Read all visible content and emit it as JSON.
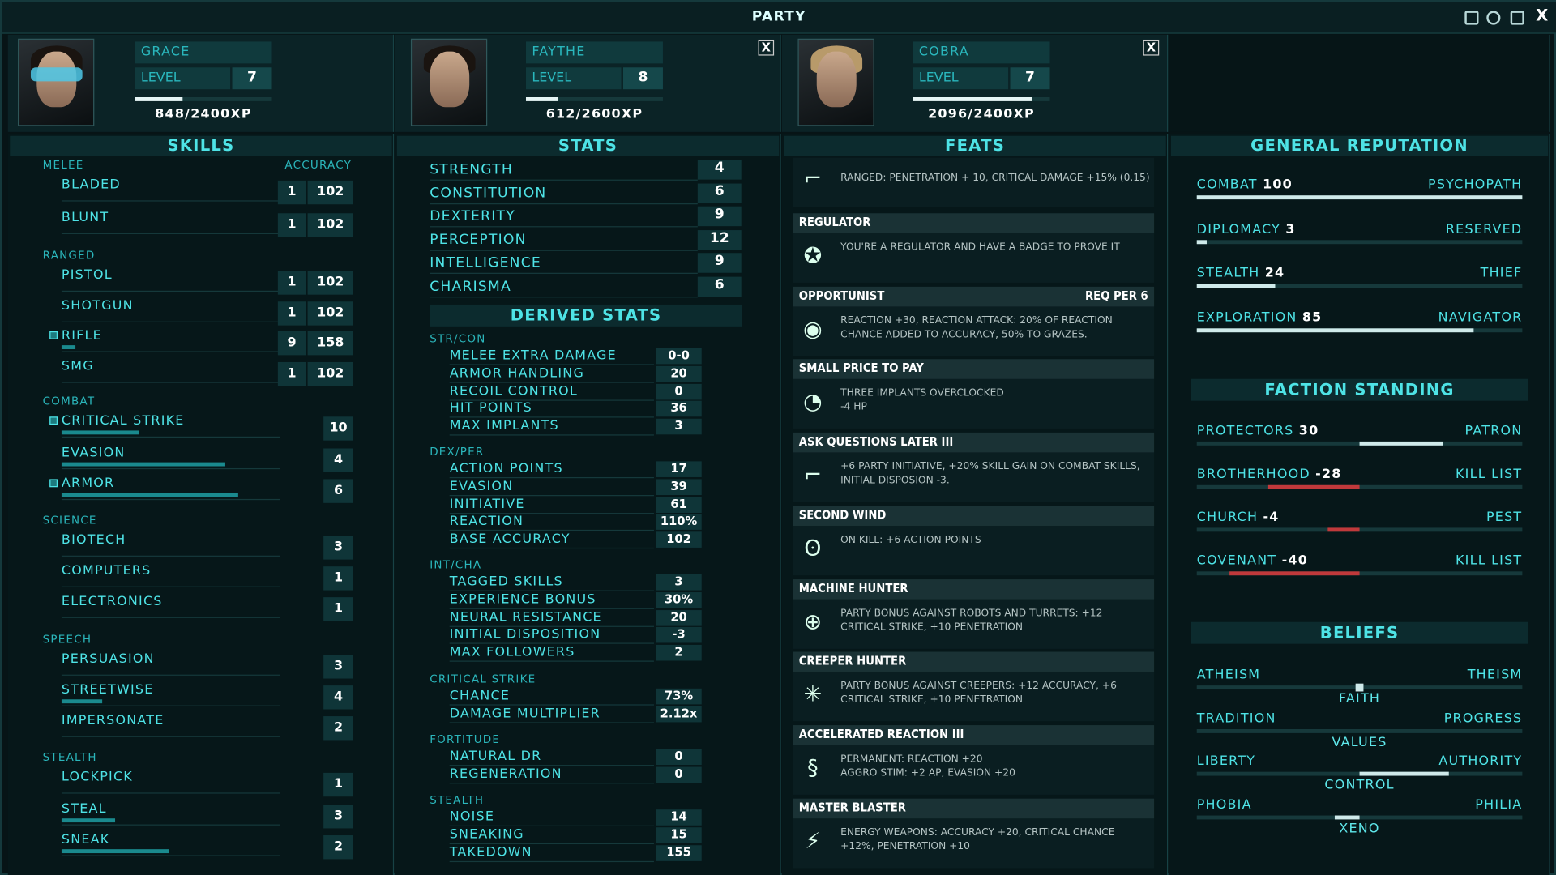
{
  "window": {
    "title": "PARTY",
    "close": "X"
  },
  "party": [
    {
      "name": "GRACE",
      "level_label": "LEVEL",
      "level": "7",
      "xp": "848/2400XP",
      "xp_fraction": 0.35
    },
    {
      "name": "FAYTHE",
      "level_label": "LEVEL",
      "level": "8",
      "xp": "612/2600XP",
      "xp_fraction": 0.235,
      "close": "X"
    },
    {
      "name": "COBRA",
      "level_label": "LEVEL",
      "level": "7",
      "xp": "2096/2400XP",
      "xp_fraction": 0.87,
      "close": "X"
    }
  ],
  "skills": {
    "header": "SKILLS",
    "accuracy_label": "ACCURACY",
    "melee_label": "MELEE",
    "ranged_label": "RANGED",
    "combat_label": "COMBAT",
    "science_label": "SCIENCE",
    "speech_label": "SPEECH",
    "stealth_label": "STEALTH",
    "melee": [
      {
        "name": "BLADED",
        "value": "1",
        "accuracy": "102"
      },
      {
        "name": "BLUNT",
        "value": "1",
        "accuracy": "102"
      }
    ],
    "ranged": [
      {
        "name": "PISTOL",
        "value": "1",
        "accuracy": "102"
      },
      {
        "name": "SHOTGUN",
        "value": "1",
        "accuracy": "102"
      },
      {
        "name": "RIFLE",
        "value": "9",
        "accuracy": "158",
        "tagged": true,
        "progress": 0.05
      },
      {
        "name": "SMG",
        "value": "1",
        "accuracy": "102"
      }
    ],
    "combat": [
      {
        "name": "CRITICAL STRIKE",
        "value": "10",
        "tagged": true,
        "progress": 0.29
      },
      {
        "name": "EVASION",
        "value": "4",
        "progress": 0.61
      },
      {
        "name": "ARMOR",
        "value": "6",
        "tagged": true,
        "progress": 0.66
      }
    ],
    "science": [
      {
        "name": "BIOTECH",
        "value": "3"
      },
      {
        "name": "COMPUTERS",
        "value": "1"
      },
      {
        "name": "ELECTRONICS",
        "value": "1"
      }
    ],
    "speech": [
      {
        "name": "PERSUASION",
        "value": "3"
      },
      {
        "name": "STREETWISE",
        "value": "4",
        "progress": 0.15
      },
      {
        "name": "IMPERSONATE",
        "value": "2"
      }
    ],
    "stealth": [
      {
        "name": "LOCKPICK",
        "value": "1"
      },
      {
        "name": "STEAL",
        "value": "3",
        "progress": 0.2
      },
      {
        "name": "SNEAK",
        "value": "2",
        "progress": 0.4
      }
    ]
  },
  "stats": {
    "header": "STATS",
    "primary": [
      {
        "name": "STRENGTH",
        "value": "4"
      },
      {
        "name": "CONSTITUTION",
        "value": "6"
      },
      {
        "name": "DEXTERITY",
        "value": "9"
      },
      {
        "name": "PERCEPTION",
        "value": "12"
      },
      {
        "name": "INTELLIGENCE",
        "value": "9"
      },
      {
        "name": "CHARISMA",
        "value": "6"
      }
    ],
    "derived_header": "DERIVED STATS",
    "groups": [
      {
        "label": "STR/CON",
        "items": [
          {
            "name": "MELEE EXTRA DAMAGE",
            "value": "0-0"
          },
          {
            "name": "ARMOR HANDLING",
            "value": "20"
          },
          {
            "name": "RECOIL CONTROL",
            "value": "0"
          },
          {
            "name": "HIT POINTS",
            "value": "36"
          },
          {
            "name": "MAX IMPLANTS",
            "value": "3"
          }
        ]
      },
      {
        "label": "DEX/PER",
        "items": [
          {
            "name": "ACTION POINTS",
            "value": "17"
          },
          {
            "name": "EVASION",
            "value": "39"
          },
          {
            "name": "INITIATIVE",
            "value": "61"
          },
          {
            "name": "REACTION",
            "value": "110%"
          },
          {
            "name": "BASE ACCURACY",
            "value": "102"
          }
        ]
      },
      {
        "label": "INT/CHA",
        "items": [
          {
            "name": "TAGGED SKILLS",
            "value": "3"
          },
          {
            "name": "EXPERIENCE BONUS",
            "value": "30%"
          },
          {
            "name": "NEURAL RESISTANCE",
            "value": "20"
          },
          {
            "name": "INITIAL DISPOSITION",
            "value": "-3"
          },
          {
            "name": "MAX FOLLOWERS",
            "value": "2"
          }
        ]
      },
      {
        "label": "CRITICAL STRIKE",
        "items": [
          {
            "name": "CHANCE",
            "value": "73%"
          },
          {
            "name": "DAMAGE MULTIPLIER",
            "value": "2.12x"
          }
        ]
      },
      {
        "label": "FORTITUDE",
        "items": [
          {
            "name": "NATURAL DR",
            "value": "0"
          },
          {
            "name": "REGENERATION",
            "value": "0"
          }
        ]
      },
      {
        "label": "STEALTH",
        "items": [
          {
            "name": "NOISE",
            "value": "14"
          },
          {
            "name": "SNEAKING",
            "value": "15"
          },
          {
            "name": "TAKEDOWN",
            "value": "155"
          }
        ]
      }
    ]
  },
  "feats": {
    "header": "FEATS",
    "items": [
      {
        "title": "",
        "req": "",
        "desc": "RANGED: PENETRATION + 10, CRITICAL DAMAGE +15% (0.15)",
        "icon": "rifle-icon"
      },
      {
        "title": "REGULATOR",
        "req": "",
        "desc": "YOU'RE A REGULATOR AND HAVE A BADGE TO PROVE IT",
        "icon": "badge-icon"
      },
      {
        "title": "OPPORTUNIST",
        "req": "REQ PER 6",
        "desc": "REACTION +30, REACTION ATTACK: 20% OF REACTION CHANCE ADDED TO ACCURACY, 50% TO GRAZES.",
        "icon": "eye-icon"
      },
      {
        "title": "SMALL PRICE TO PAY",
        "req": "",
        "desc": "THREE IMPLANTS OVERCLOCKED\n-4 HP",
        "icon": "gauge-icon"
      },
      {
        "title": "ASK QUESTIONS LATER III",
        "req": "",
        "desc": "+6 PARTY INITIATIVE, +20% SKILL GAIN ON COMBAT SKILLS, INITIAL DISPOSION -3.",
        "icon": "gun-icon"
      },
      {
        "title": "SECOND WIND",
        "req": "",
        "desc": "ON KILL: +6 ACTION POINTS",
        "icon": "lungs-icon"
      },
      {
        "title": "MACHINE HUNTER",
        "req": "",
        "desc": "PARTY BONUS AGAINST ROBOTS AND TURRETS: +12 CRITICAL STRIKE, +10 PENETRATION",
        "icon": "robot-target-icon"
      },
      {
        "title": "CREEPER HUNTER",
        "req": "",
        "desc": "PARTY BONUS AGAINST CREEPERS: +12 ACCURACY, +6 CRITICAL STRIKE, +10 PENETRATION",
        "icon": "creeper-target-icon"
      },
      {
        "title": "ACCELERATED REACTION III",
        "req": "",
        "desc": "PERMANENT: REACTION +20\nAGGRO STIM: +2 AP, EVASION +20",
        "icon": "dna-icon"
      },
      {
        "title": "MASTER BLASTER",
        "req": "",
        "desc": "ENERGY WEAPONS: ACCURACY +20, CRITICAL CHANCE +12%, PENETRATION +10",
        "icon": "blaster-icon"
      }
    ]
  },
  "reputation": {
    "header": "GENERAL REPUTATION",
    "items": [
      {
        "name": "COMBAT",
        "value": "100",
        "rank": "PSYCHOPATH",
        "fill": 1.0
      },
      {
        "name": "DIPLOMACY",
        "value": "3",
        "rank": "RESERVED",
        "fill": 0.03
      },
      {
        "name": "STEALTH",
        "value": "24",
        "rank": "THIEF",
        "fill": 0.24
      },
      {
        "name": "EXPLORATION",
        "value": "85",
        "rank": "NAVIGATOR",
        "fill": 0.85
      }
    ],
    "faction_header": "FACTION STANDING",
    "factions": [
      {
        "name": "PROTECTORS",
        "value": "30",
        "rank": "PATRON",
        "standing": 0.3
      },
      {
        "name": "BROTHERHOOD",
        "value": "-28",
        "rank": "KILL LIST",
        "standing": -0.28
      },
      {
        "name": "CHURCH",
        "value": "-4",
        "rank": "PEST",
        "standing": -0.04
      },
      {
        "name": "COVENANT",
        "value": "-40",
        "rank": "KILL LIST",
        "standing": -0.4
      }
    ],
    "beliefs_header": "BELIEFS",
    "beliefs": [
      {
        "left": "ATHEISM",
        "right": "THEISM",
        "axis": "FAITH",
        "value": 0.05
      },
      {
        "left": "TRADITION",
        "right": "PROGRESS",
        "axis": "VALUES",
        "value": 0.0
      },
      {
        "left": "LIBERTY",
        "right": "AUTHORITY",
        "axis": "CONTROL",
        "value": 0.55
      },
      {
        "left": "PHOBIA",
        "right": "PHILIA",
        "axis": "XENO",
        "value": -0.15
      }
    ]
  }
}
